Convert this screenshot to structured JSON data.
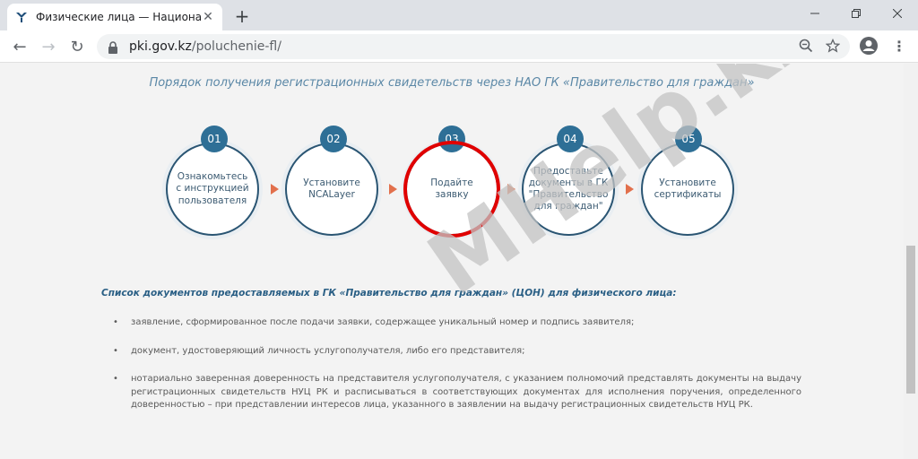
{
  "browser": {
    "tab_title": "Физические лица — Национальн",
    "url_domain": "pki.gov.kz",
    "url_path": "/poluchenie-fl/"
  },
  "page": {
    "heading": "Порядок получения регистрационных свидетельств через НАО ГК «Правительство для граждан»",
    "steps": [
      {
        "num": "01",
        "text": "Ознакомьтесь с инструкцией пользователя"
      },
      {
        "num": "02",
        "text": "Установите NCALayer"
      },
      {
        "num": "03",
        "text": "Подайте заявку"
      },
      {
        "num": "04",
        "text": "Предоставьте документы в ГК \"Правительство для граждан\""
      },
      {
        "num": "05",
        "text": "Установите сертификаты"
      }
    ],
    "list_title": "Список документов предоставляемых в ГК «Правительство для граждан» (ЦОН) для физического лица:",
    "bullet": "•",
    "documents": [
      "заявление, сформированное после подачи заявки, содержащее уникальный номер и подпись заявителя;",
      "документ, удостоверяющий личность услугополучателя, либо его представителя;",
      "нотариально заверенная доверенность на представителя услугополучателя, с указанием полномочий представлять документы на выдачу регистрационных свидетельств НУЦ РК и расписываться в соответствующих документах для исполнения поручения, определенного доверенностью – при представлении интересов лица, указанного в заявлении на выдачу регистрационных свидетельств НУЦ РК."
    ]
  },
  "watermark": "MHelp.kz",
  "colors": {
    "accent": "#2e6f96",
    "arrow": "#e2704c",
    "highlight": "#e00000"
  }
}
